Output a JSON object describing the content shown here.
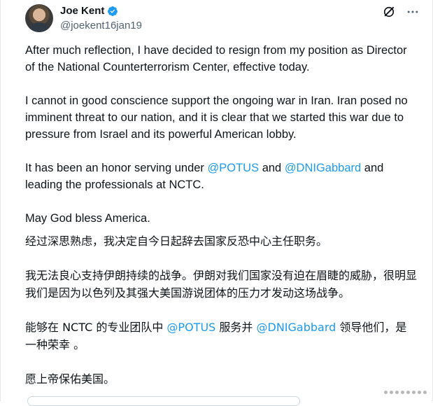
{
  "author": {
    "name": "Joe Kent",
    "handle": "@joekent16jan19",
    "verified": true
  },
  "icons": {
    "verified": "verified-badge-icon",
    "grok": "grok-icon",
    "more": "more-icon"
  },
  "colors": {
    "text": "#0f1419",
    "handle": "#536471",
    "mention": "#1d9bf0"
  },
  "post": {
    "en_p1": "After much reflection, I have decided to resign from my position as Director of the National Counterterrorism Center, effective today.",
    "en_p2": "I cannot in good conscience support the ongoing war in Iran. Iran posed no imminent threat to our nation, and it is clear that we started this war due to pressure from Israel and its powerful American lobby.",
    "en_p3_a": "It has been an honor serving under ",
    "en_p3_m1": "@POTUS",
    "en_p3_b": " and ",
    "en_p3_m2": "@DNIGabbard",
    "en_p3_c": " and leading the professionals at NCTC.",
    "en_p4": "May God bless America.",
    "zh_p1": "经过深思熟虑，我决定自今日起辞去国家反恐中心主任职务。",
    "zh_p2": "我无法良心支持伊朗持续的战争。伊朗对我们国家没有迫在眉睫的威胁，很明显我们是因为以色列及其强大美国游说团体的压力才发动这场战争。",
    "zh_p3_a": "能够在 NCTC 的专业团队中 ",
    "zh_p3_m1": "@POTUS",
    "zh_p3_b": " 服务并 ",
    "zh_p3_m2": "@DNIGabbard",
    "zh_p3_c": " 领导他们，是一种荣幸 。",
    "zh_p4": "愿上帝保佑美国。"
  }
}
